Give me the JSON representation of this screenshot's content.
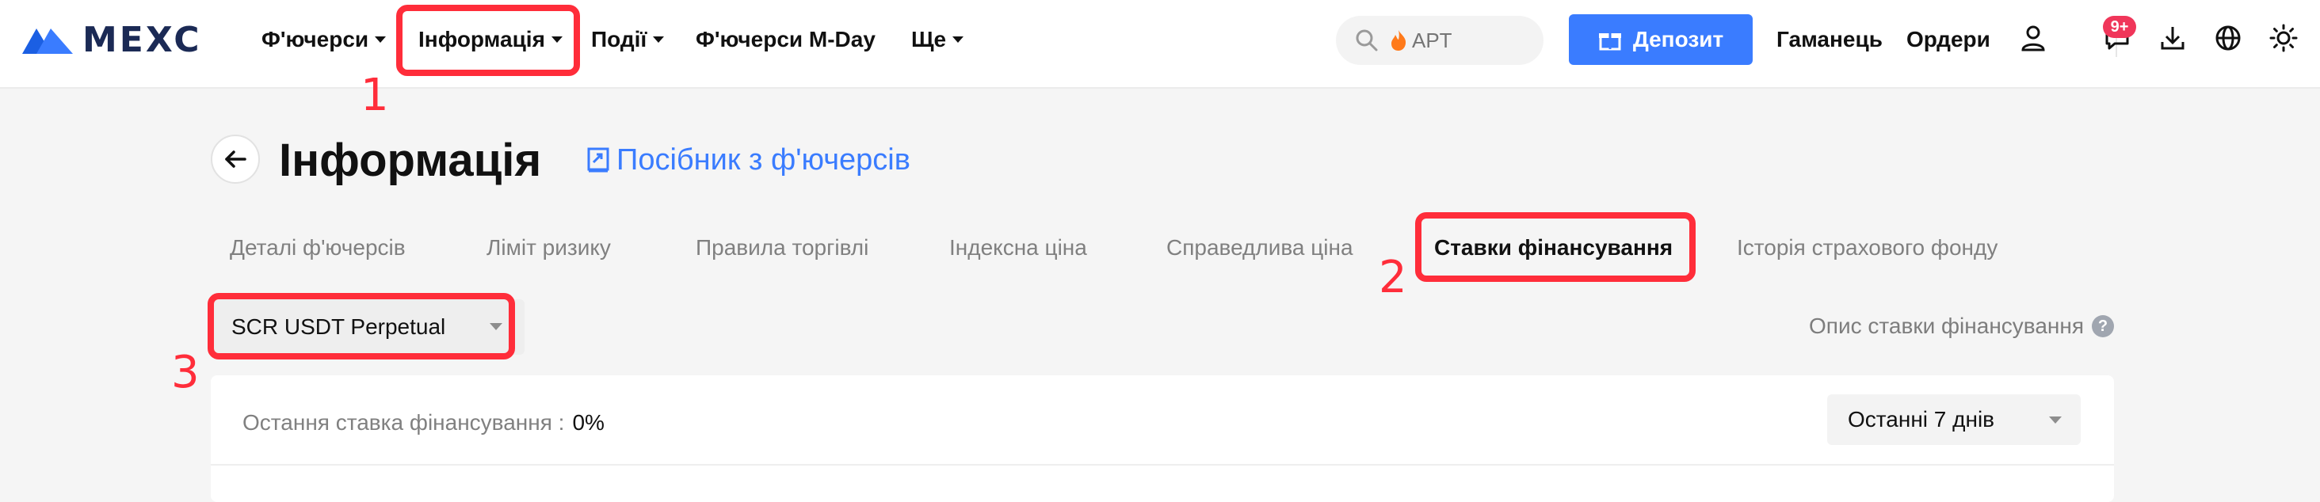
{
  "brand": {
    "name": "MEXC",
    "accent": "#3a7cff",
    "annotation_color": "#ff2d3a"
  },
  "nav": {
    "items": [
      {
        "label": "Ф'ючерси",
        "has_dropdown": true
      },
      {
        "label": "Інформація",
        "has_dropdown": true
      },
      {
        "label": "Події",
        "has_dropdown": true
      },
      {
        "label": "Ф'ючерси M-Day",
        "has_dropdown": false
      },
      {
        "label": "Ще",
        "has_dropdown": true
      }
    ]
  },
  "search": {
    "placeholder": "APT",
    "icon": "search-icon",
    "prefix_icon": "fire-icon"
  },
  "header_actions": {
    "deposit_label": "Депозит",
    "wallet_label": "Гаманець",
    "orders_label": "Ордери",
    "notification_badge": "9+"
  },
  "page": {
    "title": "Інформація",
    "guide_link": "Посібник з ф'ючерсів"
  },
  "tabs": [
    {
      "label": "Деталі ф'ючерсів",
      "active": false
    },
    {
      "label": "Ліміт ризику",
      "active": false
    },
    {
      "label": "Правила торгівлі",
      "active": false
    },
    {
      "label": "Індексна ціна",
      "active": false
    },
    {
      "label": "Справедлива ціна",
      "active": false
    },
    {
      "label": "Ставки фінансування",
      "active": true
    },
    {
      "label": "Історія страхового фонду",
      "active": false
    }
  ],
  "contract_select": {
    "value": "SCR USDT Perpetual"
  },
  "funding_description_link": "Опис ставки фінансування",
  "funding": {
    "last_rate_label": "Остання ставка фінансування :",
    "last_rate_value": "0%",
    "period_value": "Останні 7 днів"
  },
  "annotations": [
    "1",
    "2",
    "3"
  ]
}
